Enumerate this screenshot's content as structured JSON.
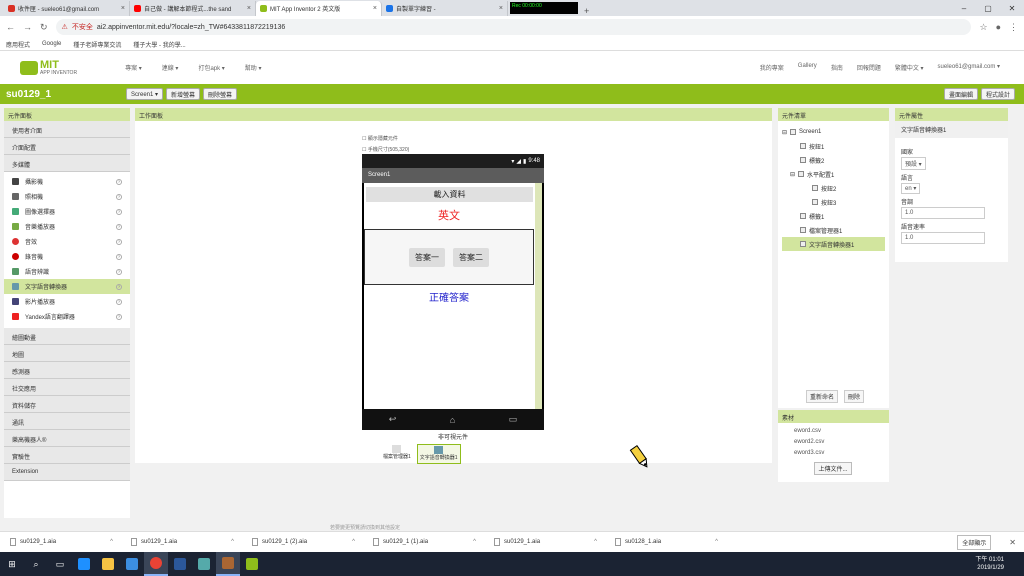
{
  "browser": {
    "tabs": [
      {
        "label": "收件匣 - sueleo61@gmail.com",
        "color": "#d93025"
      },
      {
        "label": "自己做 - 講解本節程式...the sand",
        "color": "#ff0000"
      },
      {
        "label": "MIT App Inventor 2 英文版",
        "color": "#8fbd1b",
        "active": true
      },
      {
        "label": "自製單字練習 -",
        "color": "#1a73e8"
      }
    ],
    "inset_text": "Rec 00:00:00",
    "url_warning": "不安全",
    "url": "ai2.appinventor.mit.edu/?locale=zh_TW#6433811872219136",
    "bookmarks": [
      "應用程式",
      "Google",
      "種子老師專業交流",
      "種子大學 - 我的學..."
    ]
  },
  "app": {
    "logo_line1": "MIT",
    "logo_line2": "APP INVENTOR",
    "menu": [
      "專案 ▾",
      "連線 ▾",
      "打包apk ▾",
      "幫助 ▾"
    ],
    "right_menu": [
      "我的專案",
      "Gallery",
      "指南",
      "回報問題",
      "繁體中文 ▾",
      "sueleo61@gmail.com ▾"
    ],
    "project_name": "su0129_1",
    "screen_btn": "Screen1 ▾",
    "add_screen": "新增螢幕",
    "remove_screen": "刪除螢幕",
    "designer_btn": "畫面編輯",
    "blocks_btn": "程式設計"
  },
  "palette": {
    "title": "元件面板",
    "cats_top": [
      "使用者介面",
      "介面配置",
      "多媒體"
    ],
    "items": [
      {
        "label": "攝影機",
        "color": "#444"
      },
      {
        "label": "照相機",
        "color": "#666"
      },
      {
        "label": "圖像選擇器",
        "color": "#4a7"
      },
      {
        "label": "音樂播放器",
        "color": "#7a4"
      },
      {
        "label": "音效",
        "color": "#d33"
      },
      {
        "label": "錄音機",
        "color": "#c00"
      },
      {
        "label": "語音辨識",
        "color": "#596"
      },
      {
        "label": "文字語音轉換器",
        "color": "#69a",
        "selected": true
      },
      {
        "label": "影片播放器",
        "color": "#447"
      },
      {
        "label": "Yandex語言翻譯器",
        "color": "#e22"
      }
    ],
    "cats_bottom": [
      "繪圖動畫",
      "地圖",
      "感測器",
      "社交應用",
      "資料儲存",
      "通訊",
      "樂高機器人®",
      "實驗性",
      "Extension"
    ]
  },
  "viewer": {
    "title": "工作面板",
    "chk1": "顯示隱藏元件",
    "chk2": "手機尺寸(505,320)",
    "time": "9:48",
    "screen_title": "Screen1",
    "load_btn": "載入資料",
    "word": "英文",
    "ans1": "答案一",
    "ans2": "答案二",
    "correct": "正確答案",
    "nonvisible": "非可視元件",
    "nv_items": [
      "檔案管理器1",
      "文字語音轉換器1"
    ],
    "hint": "若要變更預覽請切換到其他設定"
  },
  "tree": {
    "title": "元件清單",
    "nodes": [
      {
        "label": "Screen1",
        "indent": 0
      },
      {
        "label": "按鈕1",
        "indent": 1
      },
      {
        "label": "標籤2",
        "indent": 1
      },
      {
        "label": "水平配置1",
        "indent": 1
      },
      {
        "label": "按鈕2",
        "indent": 2
      },
      {
        "label": "按鈕3",
        "indent": 2
      },
      {
        "label": "標籤1",
        "indent": 1
      },
      {
        "label": "檔案管理器1",
        "indent": 1
      },
      {
        "label": "文字語音轉換器1",
        "indent": 1,
        "selected": true
      }
    ],
    "rename": "重新命名",
    "delete": "刪除"
  },
  "media": {
    "title": "素材",
    "files": [
      "eword.csv",
      "eword2.csv",
      "eword3.csv"
    ],
    "upload": "上傳文件..."
  },
  "props": {
    "title": "元件屬性",
    "component": "文字語音轉換器1",
    "country_label": "國家",
    "country": "預設 ▾",
    "lang_label": "語言",
    "lang": "en ▾",
    "pitch_label": "音調",
    "pitch": "1.0",
    "rate_label": "語音速率",
    "rate": "1.0"
  },
  "downloads": {
    "files": [
      "su0129_1.aia",
      "su0129_1.aia",
      "su0129_1 (2).aia",
      "su0129_1 (1).aia",
      "su0129_1.aia",
      "su0128_1.aia"
    ],
    "show_all": "全部顯示"
  },
  "taskbar": {
    "time": "下午 01:01",
    "date": "2019/1/29"
  }
}
